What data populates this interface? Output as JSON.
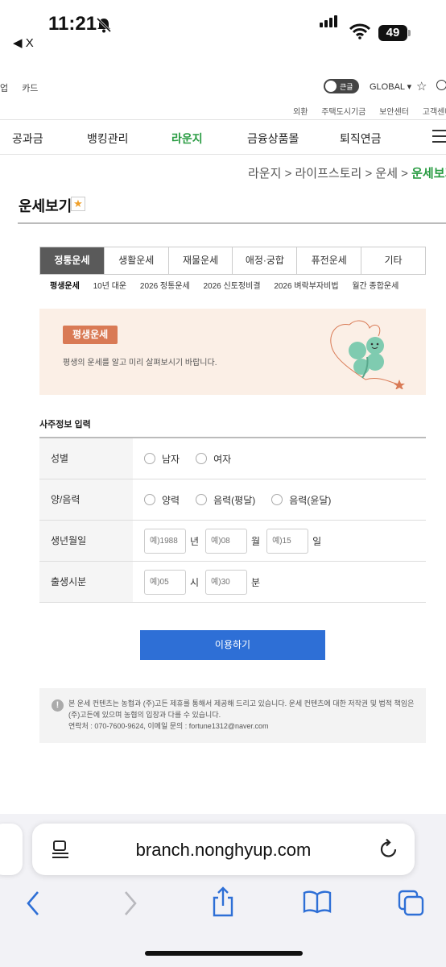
{
  "status_bar": {
    "time": "11:21",
    "back_app": "◀ X",
    "battery": "49"
  },
  "util": {
    "left_items": [
      "업",
      "카드"
    ],
    "toggle_label": "큰글",
    "global": "GLOBAL ▾",
    "right_items": [
      "외환",
      "주택도시기금",
      "보안센터",
      "고객센터"
    ]
  },
  "gnb": {
    "items": [
      "공과금",
      "뱅킹관리",
      "라운지",
      "금융상품몰",
      "퇴직연금"
    ],
    "active_color": "#2a9c43"
  },
  "breadcrumb": {
    "path": "라운지 > 라이프스토리 > 운세 > ",
    "current": "운세보기"
  },
  "page": {
    "title": "운세보기"
  },
  "tabs": [
    "정통운세",
    "생활운세",
    "재물운세",
    "애정·궁합",
    "퓨전운세",
    "기타"
  ],
  "subtabs": [
    "평생운세",
    "10년 대운",
    "2026 정통운세",
    "2026 신토정비결",
    "2026 벼락부자비법",
    "월간 종합운세"
  ],
  "banner": {
    "badge": "평생운세",
    "desc": "평생의 운세를 알고 미리 살펴보시기 바랍니다."
  },
  "form": {
    "title": "사주정보 입력",
    "gender": {
      "label": "성별",
      "options": [
        "남자",
        "여자"
      ]
    },
    "calendar": {
      "label": "양/음력",
      "options": [
        "양력",
        "음력(평달)",
        "음력(윤달)"
      ]
    },
    "birth": {
      "label": "생년월일",
      "year_ph": "예)1988",
      "year_unit": "년",
      "month_ph": "예)08",
      "month_unit": "월",
      "day_ph": "예)15",
      "day_unit": "일"
    },
    "time": {
      "label": "출생시분",
      "hour_ph": "예)05",
      "hour_unit": "시",
      "min_ph": "예)30",
      "min_unit": "분"
    },
    "submit": "이용하기"
  },
  "notice": {
    "line1": "본 운세 컨텐츠는 농협과 (주)고든 제휴를 통해서 제공해 드리고 있습니다. 운세 컨텐츠에 대한 저작권 및 법적 책임은 (주)고든에 있으며 농협의 입장과 다를 수 있습니다.",
    "line2": "연락처 : 070-7600-9624, 이메일 문의 : fortune1312@naver.com"
  },
  "safari": {
    "url": "branch.nonghyup.com"
  }
}
